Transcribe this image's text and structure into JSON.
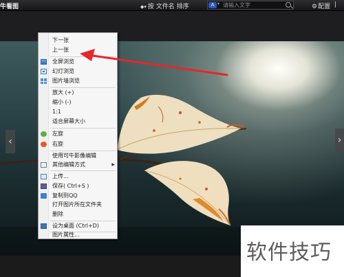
{
  "toolbar": {
    "app_title": "牛看图",
    "sort_label": "按 文件名 排序",
    "search_engine_label": "A",
    "search_placeholder": "请输入文字",
    "config_label": "配置",
    "extra_label": "|"
  },
  "context_menu": {
    "items": [
      {
        "label": "下一张",
        "icon": "none"
      },
      {
        "label": "上一张",
        "icon": "none"
      },
      {
        "label": "全屏浏览",
        "icon": "fullscreen-icon"
      },
      {
        "label": "幻灯浏览",
        "icon": "slideshow-icon"
      },
      {
        "label": "图片墙浏览",
        "icon": "image-wall-icon"
      },
      {
        "label": "放大 (+)",
        "icon": "none"
      },
      {
        "label": "缩小 (-)",
        "icon": "none"
      },
      {
        "label": "1:1",
        "icon": "none"
      },
      {
        "label": "适合屏幕大小",
        "icon": "none"
      },
      {
        "label": "左旋",
        "icon": "rotate-left-icon"
      },
      {
        "label": "右旋",
        "icon": "rotate-right-icon"
      },
      {
        "label": "使用可牛影像编辑",
        "icon": "none"
      },
      {
        "label": "其他编辑方式",
        "icon": "edit-list-icon"
      },
      {
        "label": "上传...",
        "icon": "upload-icon"
      },
      {
        "label": "保存( Ctrl+S )",
        "icon": "save-icon"
      },
      {
        "label": "复制到QQ",
        "icon": "qq-icon"
      },
      {
        "label": "打开图片所在文件夹",
        "icon": "none"
      },
      {
        "label": "删除",
        "icon": "none"
      },
      {
        "label": "设为桌面    (Ctrl+D)",
        "icon": "desktop-icon"
      },
      {
        "label": "图片属性...",
        "icon": "none"
      }
    ]
  },
  "viewer": {
    "prev_arrow": "‹",
    "next_arrow": "›"
  },
  "watermark": {
    "text": "软件技巧"
  },
  "colors": {
    "annotation_arrow": "#e8262b",
    "toolbar_bg": "#1e1e20",
    "menu_bg": "#f6f6f6"
  }
}
